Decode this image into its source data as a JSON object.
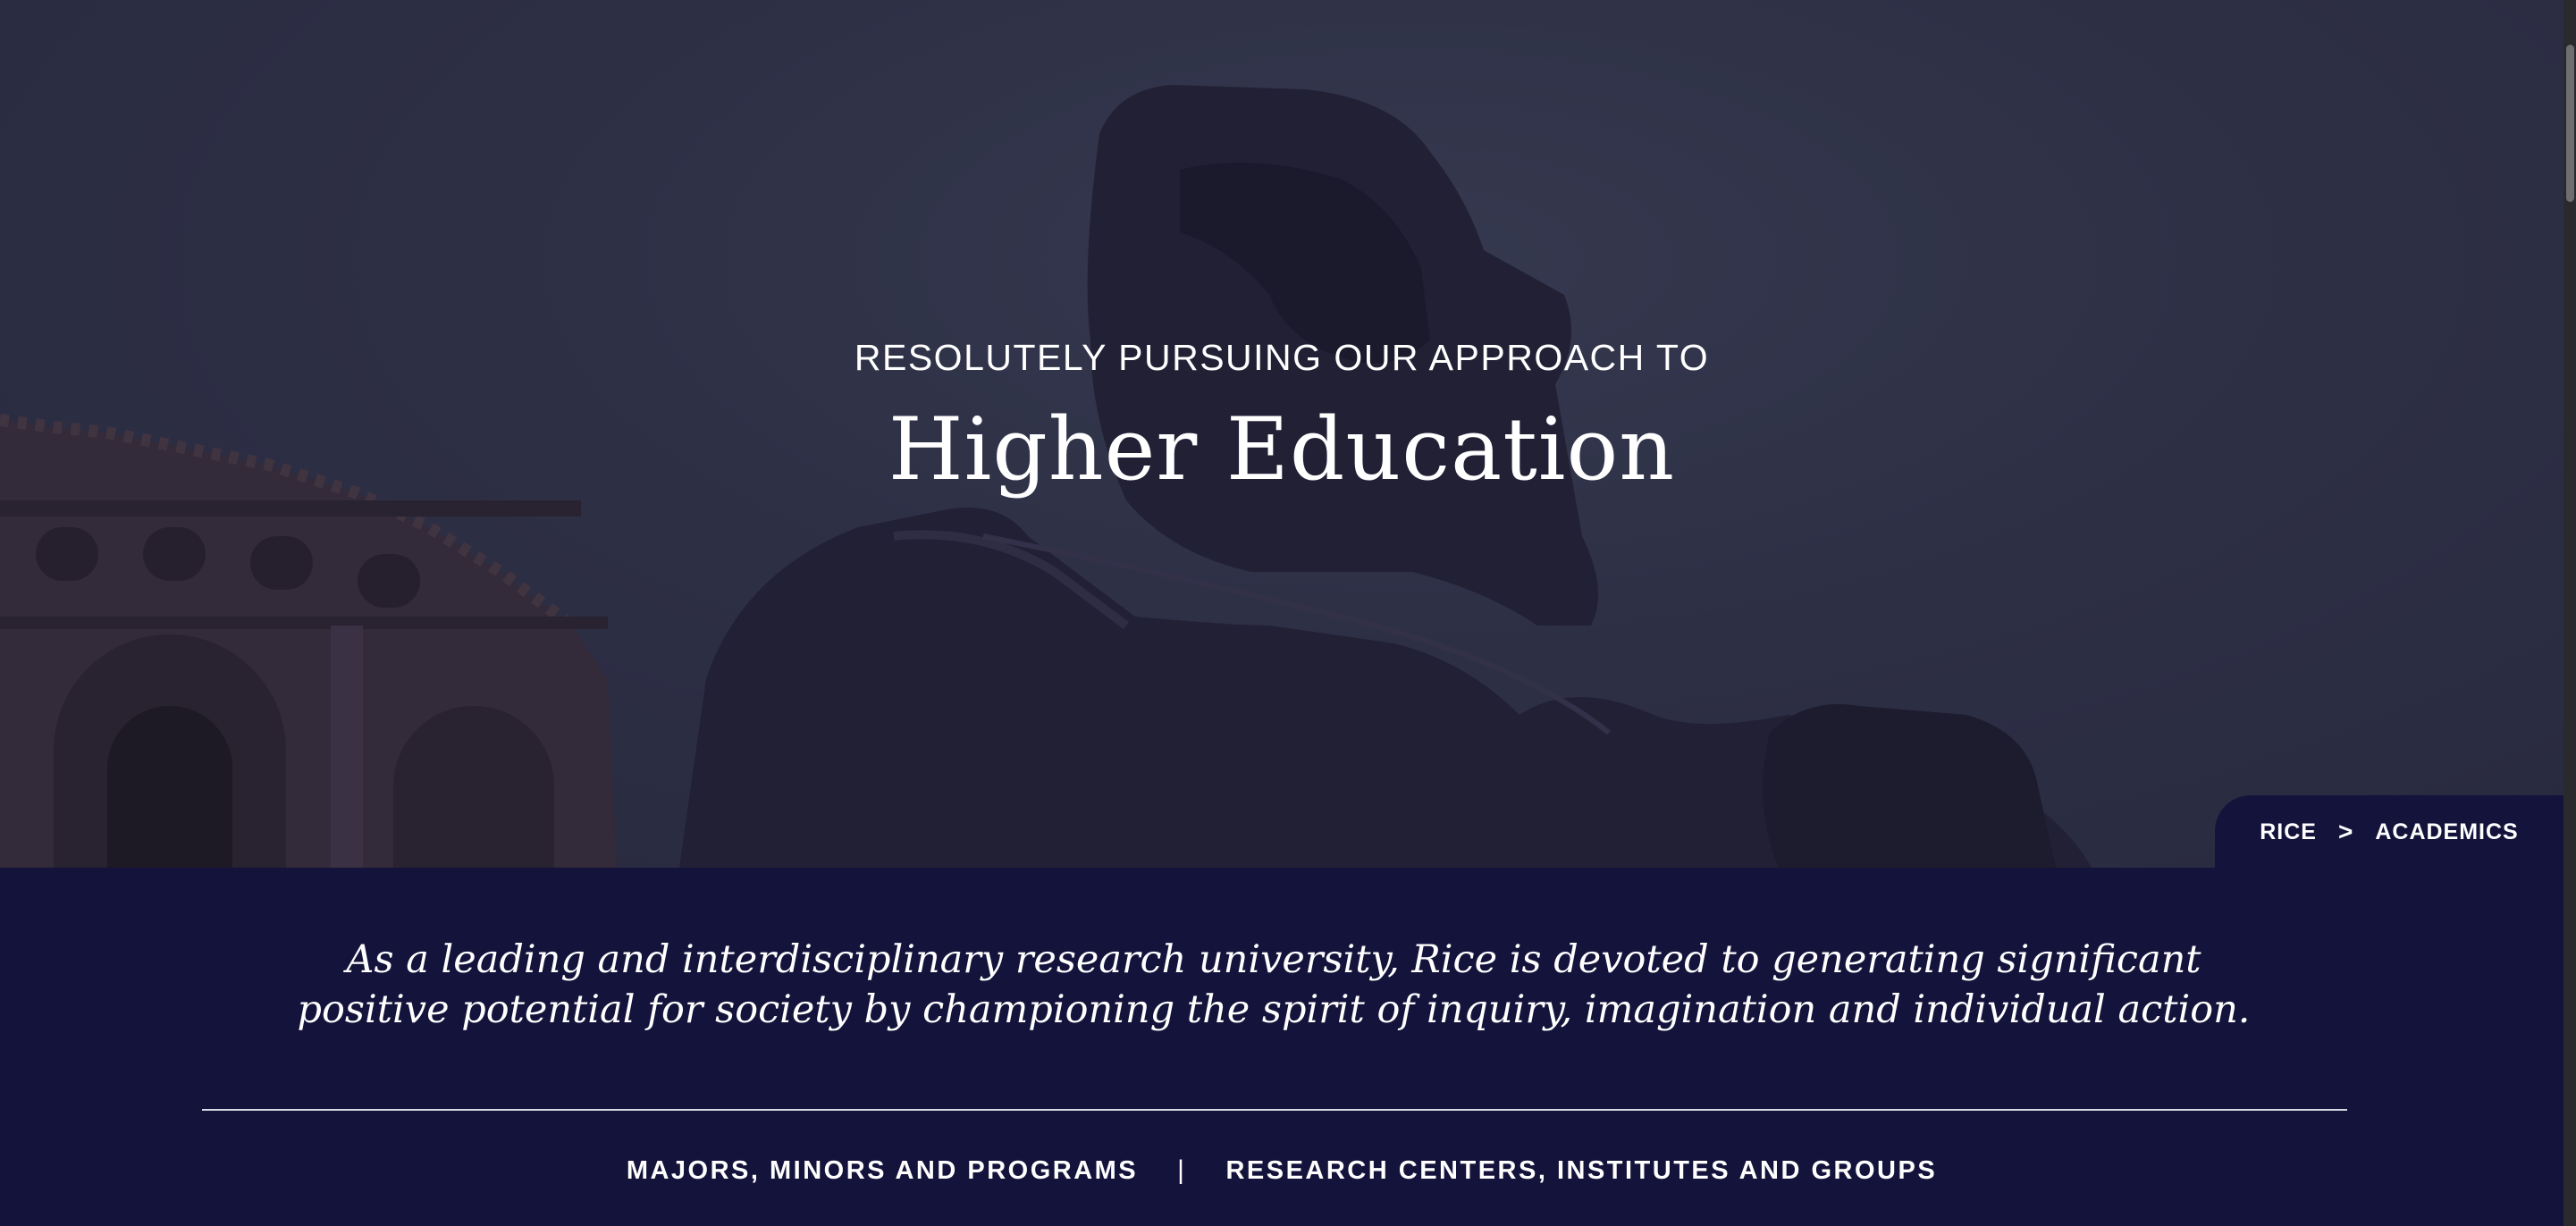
{
  "hero": {
    "kicker": "RESOLUTELY PURSUING OUR APPROACH TO",
    "title": "Higher Education"
  },
  "breadcrumb": {
    "items": [
      {
        "label": "RICE"
      },
      {
        "label": "ACADEMICS"
      }
    ],
    "separator": ">"
  },
  "mission": {
    "text": "As a leading and interdisciplinary research university, Rice is devoted to generating significant positive potential for society by championing the spirit of inquiry, imagination and individual action."
  },
  "links": {
    "items": [
      {
        "label": "MAJORS, MINORS AND PROGRAMS"
      },
      {
        "label": "RESEARCH CENTERS, INSTITUTES AND GROUPS"
      }
    ],
    "separator": "|"
  },
  "colors": {
    "navy": "#14133b",
    "hero_overlay": "#33364b",
    "text": "#ffffff"
  }
}
